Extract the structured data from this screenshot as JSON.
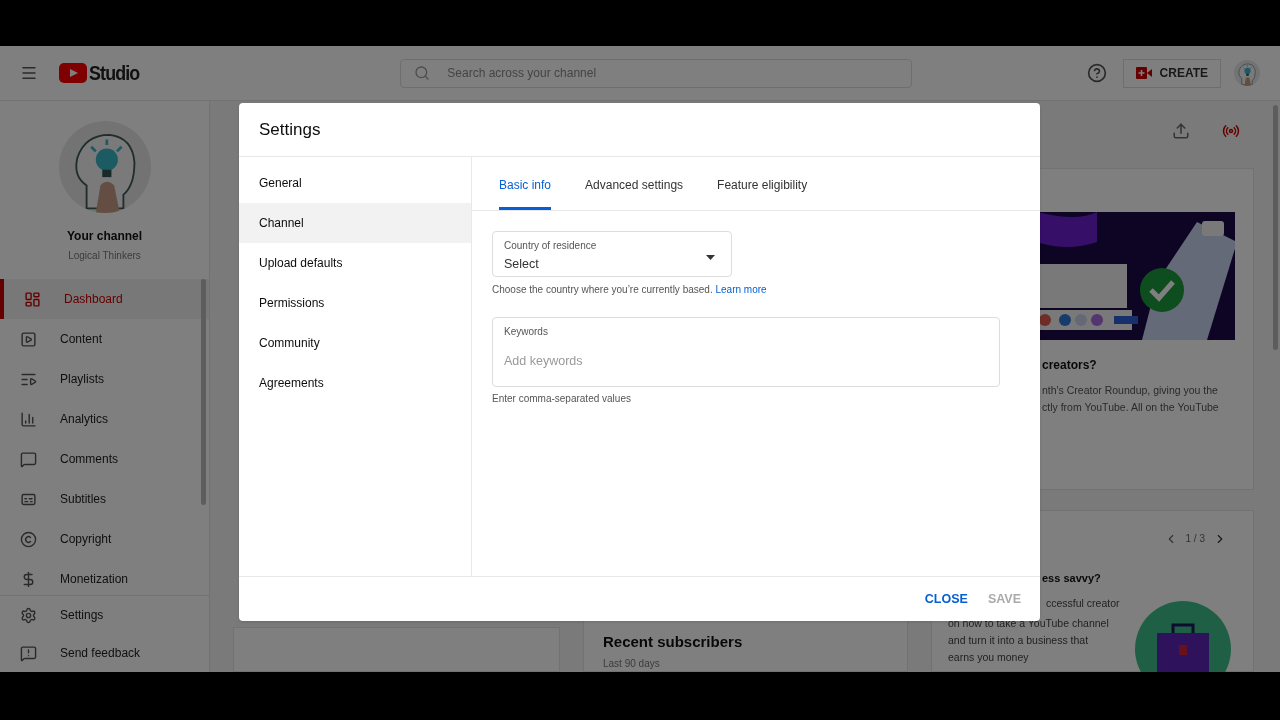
{
  "topbar": {
    "logo_text": "Studio",
    "search": {
      "placeholder": "Search across your channel"
    },
    "create_button": "CREATE"
  },
  "sidebar": {
    "channel_title": "Your channel",
    "channel_name": "Logical Thinkers",
    "items": [
      {
        "label": "Dashboard",
        "selected": true
      },
      {
        "label": "Content",
        "selected": false
      },
      {
        "label": "Playlists",
        "selected": false
      },
      {
        "label": "Analytics",
        "selected": false
      },
      {
        "label": "Comments",
        "selected": false
      },
      {
        "label": "Subtitles",
        "selected": false
      },
      {
        "label": "Copyright",
        "selected": false
      },
      {
        "label": "Monetization",
        "selected": false
      }
    ],
    "footer_items": [
      {
        "label": "Settings"
      },
      {
        "label": "Send feedback"
      }
    ]
  },
  "dashboard": {
    "news_card": {
      "title": "creators?",
      "lines": [
        "nth's Creator Roundup, giving you the",
        "ctly from YouTube. All on the YouTube"
      ]
    },
    "tips_card": {
      "pager": "1 / 3",
      "title": "ess savvy?",
      "lines": [
        "ccessful creator",
        "on how to take a YouTube channel",
        "and turn it into a business that",
        "earns you money"
      ]
    },
    "subscribers_card": {
      "title": "Recent subscribers",
      "subtitle": "Last 90 days"
    }
  },
  "dialog": {
    "title": "Settings",
    "nav": [
      {
        "label": "General",
        "selected": false
      },
      {
        "label": "Channel",
        "selected": true
      },
      {
        "label": "Upload defaults",
        "selected": false
      },
      {
        "label": "Permissions",
        "selected": false
      },
      {
        "label": "Community",
        "selected": false
      },
      {
        "label": "Agreements",
        "selected": false
      }
    ],
    "tabs": [
      {
        "label": "Basic info",
        "selected": true
      },
      {
        "label": "Advanced settings",
        "selected": false
      },
      {
        "label": "Feature eligibility",
        "selected": false
      }
    ],
    "country": {
      "label": "Country of residence",
      "value": "Select",
      "helper": "Choose the country where you’re currently based.",
      "link": "Learn more"
    },
    "keywords": {
      "label": "Keywords",
      "placeholder": "Add keywords",
      "helper": "Enter comma-separated values"
    },
    "buttons": [
      {
        "label": "CLOSE",
        "disabled": false
      },
      {
        "label": "SAVE",
        "disabled": true
      }
    ]
  }
}
